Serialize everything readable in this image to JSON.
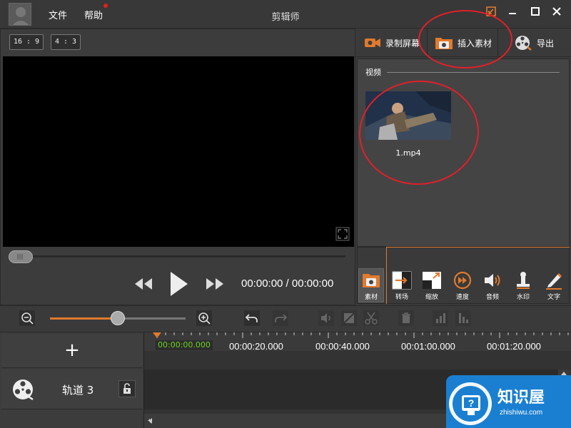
{
  "window": {
    "menu": {
      "file": "文件",
      "help": "帮助"
    },
    "title": "剪辑师"
  },
  "preview": {
    "aspect_buttons": [
      "16 : 9",
      "4 : 3"
    ],
    "time": "00:00:00 / 00:00:00",
    "progress_fraction": 0.0
  },
  "right_panel": {
    "record_label": "录制屏幕",
    "insert_label": "插入素材",
    "export_label": "导出",
    "category": "视频",
    "media": [
      {
        "name": "1.mp4"
      }
    ]
  },
  "tools": [
    {
      "label": "素材",
      "icon": "material-icon"
    },
    {
      "label": "转场",
      "icon": "transition-icon"
    },
    {
      "label": "缩放",
      "icon": "zoom-icon"
    },
    {
      "label": "速度",
      "icon": "speed-icon"
    },
    {
      "label": "音频",
      "icon": "audio-icon"
    },
    {
      "label": "水印",
      "icon": "watermark-icon"
    },
    {
      "label": "文字",
      "icon": "text-icon"
    }
  ],
  "timeline": {
    "zoom_fraction": 0.5,
    "current_time": "00:00:00.000",
    "ruler_labels": [
      "00:00:20.000",
      "00:00:40.000",
      "00:01:00.000",
      "00:01:20.000"
    ],
    "track": {
      "name": "轨道 3"
    },
    "add_symbol": "+"
  },
  "watermark": {
    "brand": "知识屋",
    "url": "zhishiwu.com"
  },
  "colors": {
    "accent": "#e07a2e",
    "annotation": "#e0202a",
    "playhead_time": "#6fd41f",
    "watermark_blue": "#1a7fd0"
  }
}
